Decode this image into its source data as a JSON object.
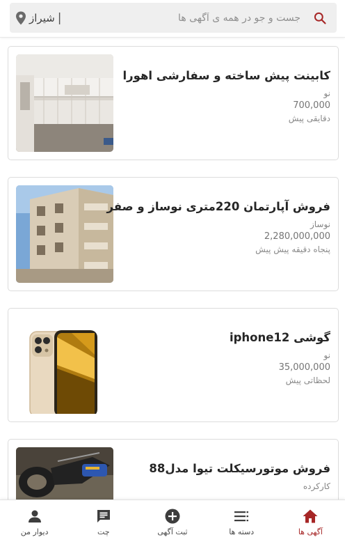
{
  "search": {
    "placeholder": "جست و جو در همه ی آگهی ها",
    "city": "شیراز",
    "separator": "|"
  },
  "listings": [
    {
      "title": "کابینت پیش ساخته و سفارشی اهورا",
      "condition": "نو",
      "price": "700,000",
      "time": "دقایقی پیش",
      "image": "kitchen-cabinet-photo"
    },
    {
      "title": "فروش آپارتمان 220متری نوساز و صفر",
      "condition": "نوساز",
      "price": "2,280,000,000",
      "time": "پنجاه دقیقه پیش پیش",
      "image": "apartment-building-photo"
    },
    {
      "title": "گوشی iphone12",
      "condition": "نو",
      "price": "35,000,000",
      "time": "لحظاتی پیش",
      "image": "iphone-photo"
    },
    {
      "title": "فروش موتورسیکلت تیوا مدل88",
      "condition": "کارکرده",
      "price": "",
      "time": "",
      "image": "motorcycle-photo"
    }
  ],
  "nav": [
    {
      "label": "آگهی ها",
      "icon": "home-icon",
      "active": true
    },
    {
      "label": "دسته ها",
      "icon": "categories-icon",
      "active": false
    },
    {
      "label": "ثبت آگهی",
      "icon": "add-circle-icon",
      "active": false
    },
    {
      "label": "چت",
      "icon": "chat-icon",
      "active": false
    },
    {
      "label": "دیوار من",
      "icon": "person-icon",
      "active": false
    }
  ],
  "colors": {
    "accent": "#a62626",
    "nav_icon": "#3d3d3d"
  }
}
